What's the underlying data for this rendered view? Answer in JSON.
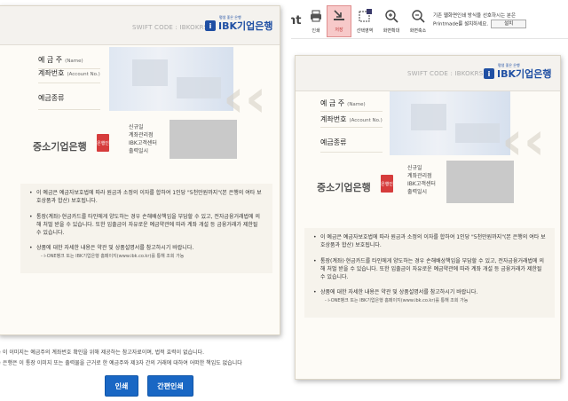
{
  "toolbar": {
    "items": [
      {
        "label": "인쇄",
        "icon": "print-icon"
      },
      {
        "label": "저장",
        "icon": "save-icon"
      },
      {
        "label": "선택영역",
        "icon": "select-area-icon"
      },
      {
        "label": "화면확대",
        "icon": "zoom-in-icon"
      },
      {
        "label": "화면축소",
        "icon": "zoom-out-icon"
      }
    ],
    "partial_label": "nt",
    "printmade_line1": "기존 웹화면인쇄 방식을 선호하시는 분은",
    "printmade_line2": "Printmade를 설치하세요.",
    "install_label": "설치"
  },
  "passbook": {
    "swift_code": "SWIFT CODE : IBKOKRSE",
    "bank_brand": "IBK기업은행",
    "brand_tagline": "평생 좋은 은행",
    "fields": [
      {
        "label": "예 금 주",
        "en": "(Name)"
      },
      {
        "label": "계좌번호",
        "en": "(Account No.)"
      },
      {
        "label": "예금종류",
        "en": ""
      }
    ],
    "bank_name": "중소기업은행",
    "stamp_text": "은행인",
    "branch_lines": [
      "신규일",
      "계좌관리점",
      "IBK고객센터",
      "출력일시"
    ],
    "notes": [
      {
        "text": "이 예금은 예금자보호법에 따라 원금과 소정의 이자를 합하여 1인당 \"5천만원까지\"(본 은행의 여타 보호상품과 합산) 보호됩니다.",
        "sub": ""
      },
      {
        "text": "통장(계좌)·현금카드를 타인에게 양도하는 경우 손해배상책임을 부담할 수 있고, 전자금융거래법에 의해 처벌 받을 수 있습니다. 또한 입출금이 자유로운 예금약관에 따라 계좌 개설 등 금융거래가 제한될 수 있습니다.",
        "sub": ""
      },
      {
        "text": "상품에 대한 자세한 내용은 약관 및 상품설명서를 참고하시기 바랍니다.",
        "sub": "- i-ONE뱅크 또는 IBK기업은행 홈페이지(www.ibk.co.kr)를 통해 조회 가능"
      }
    ]
  },
  "disclaimer": {
    "line1": "※ 이 이미지는 예금주의 계좌번호 확인을 위해 제공하는 참고자료이며, 법적 효력이 없습니다.",
    "line2": "※ 은행은 이 통장 이미지 또는 출력물을 근거로 한 예금주와 제3자 간의 거래에 대하여 어떠한 책임도 없습니다"
  },
  "buttons": {
    "print": "인쇄",
    "simple_print": "간편인쇄"
  },
  "colors": {
    "brand": "#1f4fa3",
    "button": "#1967c4",
    "stamp": "#d63c3c",
    "save_active_bg": "#f7c9c9"
  }
}
